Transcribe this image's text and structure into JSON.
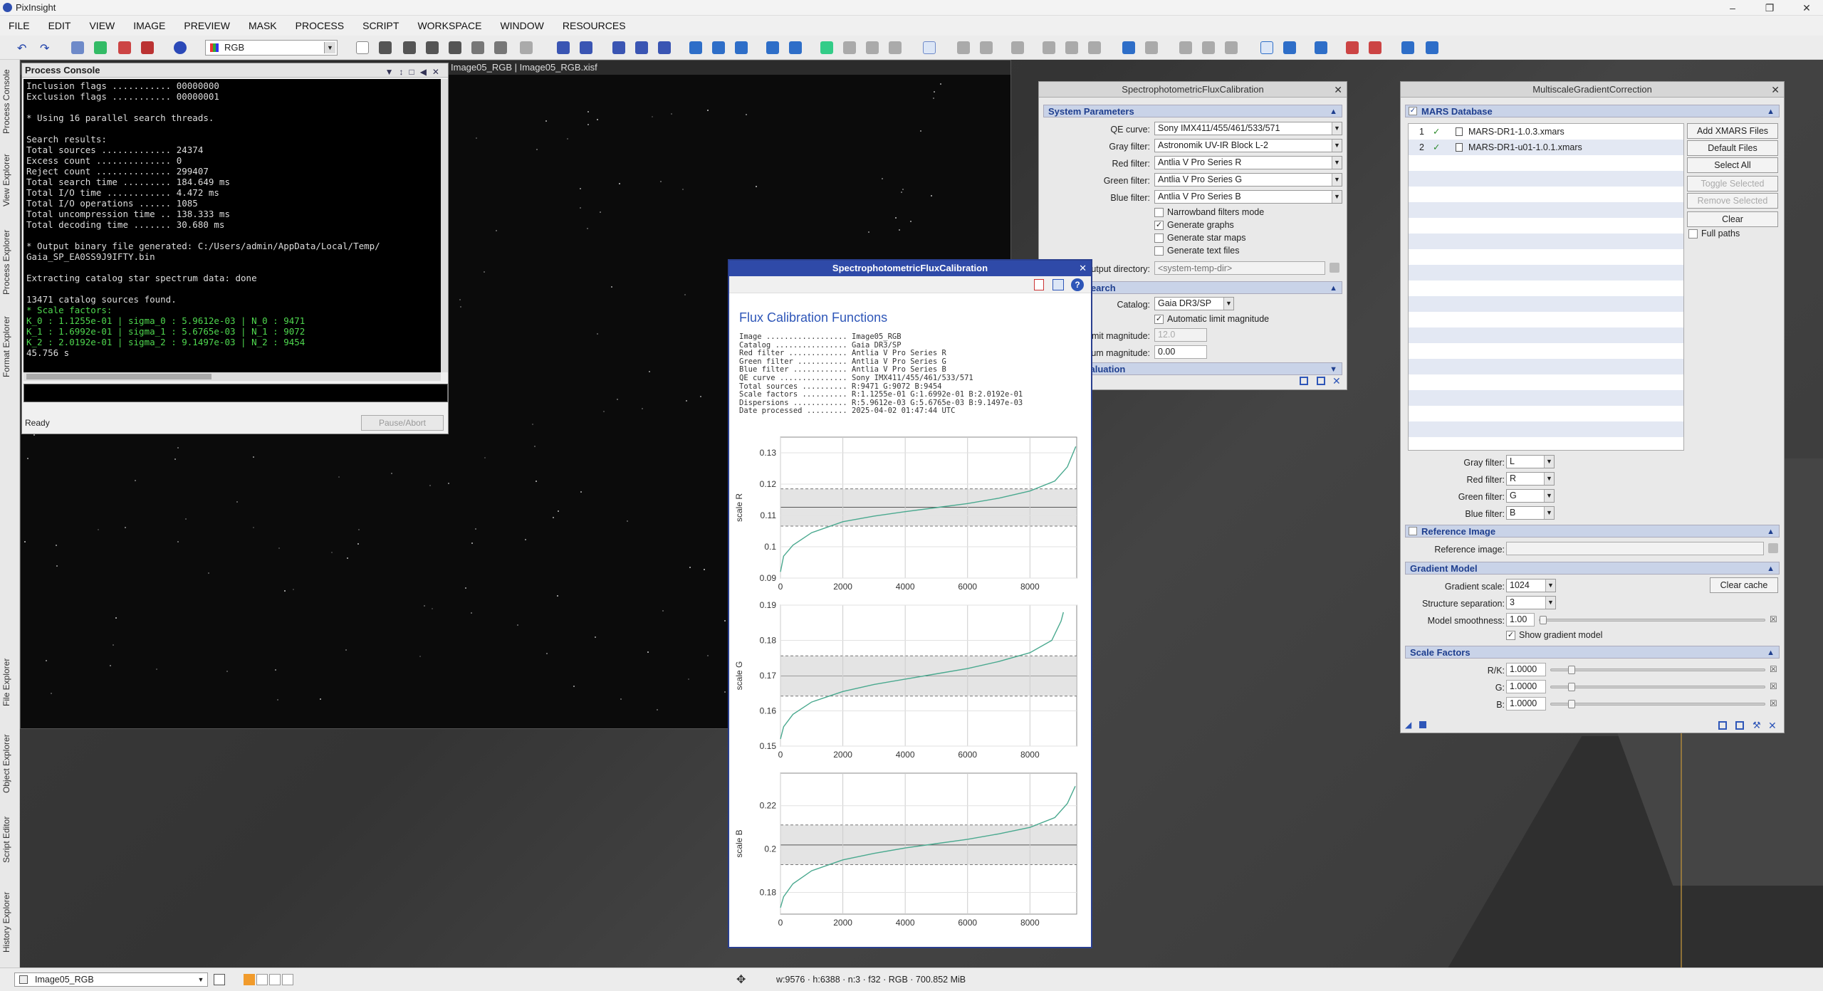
{
  "app": {
    "title": "PixInsight"
  },
  "menu": [
    "FILE",
    "EDIT",
    "VIEW",
    "IMAGE",
    "PREVIEW",
    "MASK",
    "PROCESS",
    "SCRIPT",
    "WORKSPACE",
    "WINDOW",
    "RESOURCES"
  ],
  "toolbar": {
    "color_space": "RGB"
  },
  "left_dock": [
    "Process Console",
    "View Explorer",
    "Process Explorer",
    "Format Explorer",
    "File Explorer",
    "Object Explorer",
    "Script Editor",
    "History Explorer"
  ],
  "image_window": {
    "title": "Image05_RGB | Image05_RGB.xisf"
  },
  "console": {
    "title": "Process Console",
    "lines": [
      "Inclusion flags ........... 00000000",
      "Exclusion flags ........... 00000001",
      "",
      "* Using 16 parallel search threads.",
      "",
      "Search results:",
      "Total sources ............. 24374",
      "Excess count .............. 0",
      "Reject count .............. 299407",
      "Total search time ......... 184.649 ms",
      "Total I/O time ............ 4.472 ms",
      "Total I/O operations ...... 1085",
      "Total uncompression time .. 138.333 ms",
      "Total decoding time ....... 30.680 ms",
      "",
      "* Output binary file generated: C:/Users/admin/AppData/Local/Temp/",
      "Gaia_SP_EA0SS9J9IFTY.bin",
      "",
      "Extracting catalog star spectrum data: done",
      "",
      "13471 catalog sources found."
    ],
    "green_lines": [
      "* Scale factors:",
      "K_0 : 1.1255e-01 | sigma_0 : 5.9612e-03 | N_0 : 9471",
      "K_1 : 1.6992e-01 | sigma_1 : 5.6765e-03 | N_1 : 9072",
      "K_2 : 2.0192e-01 | sigma_2 : 9.1497e-03 | N_2 : 9454"
    ],
    "elapsed": "45.756 s",
    "status": "Ready",
    "pause_label": "Pause/Abort"
  },
  "spfc": {
    "title": "SpectrophotometricFluxCalibration",
    "sec_system": "System Parameters",
    "qe_label": "QE curve:",
    "qe_value": "Sony IMX411/455/461/533/571",
    "gray_label": "Gray filter:",
    "gray_value": "Astronomik UV-IR Block L-2",
    "red_label": "Red filter:",
    "red_value": "Antlia V Pro Series R",
    "green_label": "Green filter:",
    "green_value": "Antlia V Pro Series G",
    "blue_label": "Blue filter:",
    "blue_value": "Antlia V Pro Series B",
    "narrowband": "Narrowband filters mode",
    "gen_graphs": "Generate graphs",
    "gen_star_maps": "Generate star maps",
    "gen_text": "Generate text files",
    "outdir_label": "Output directory:",
    "outdir_placeholder": "<system-temp-dir>",
    "sec_search": "Catalog Search",
    "catalog_label": "Catalog:",
    "catalog_value": "Gaia DR3/SP",
    "auto_limit": "Automatic limit magnitude",
    "limit_label": "Limit magnitude:",
    "limit_value": "12.0",
    "minmag_label": "Minimum magnitude:",
    "minmag_value": "0.00",
    "sec_signal": "Signal Evaluation"
  },
  "mgc": {
    "title": "MultiscaleGradientCorrection",
    "sec_mars": "MARS Database",
    "files": [
      {
        "n": "1",
        "name": "MARS-DR1-1.0.3.xmars"
      },
      {
        "n": "2",
        "name": "MARS-DR1-u01-1.0.1.xmars"
      }
    ],
    "btn_add": "Add XMARS Files",
    "btn_default": "Default Files",
    "btn_selall": "Select All",
    "btn_toggle": "Toggle Selected",
    "btn_remove": "Remove Selected",
    "btn_clear": "Clear",
    "full_paths": "Full paths",
    "gray_label": "Gray filter:",
    "gray_value": "L",
    "red_label": "Red filter:",
    "red_value": "R",
    "green_label": "Green filter:",
    "green_value": "G",
    "blue_label": "Blue filter:",
    "blue_value": "B",
    "sec_ref": "Reference Image",
    "ref_label": "Reference image:",
    "sec_grad": "Gradient Model",
    "scale_label": "Gradient scale:",
    "scale_value": "1024",
    "clear_cache": "Clear cache",
    "struct_label": "Structure separation:",
    "struct_value": "3",
    "smooth_label": "Model smoothness:",
    "smooth_value": "1.00",
    "show_model": "Show gradient model",
    "sec_scale": "Scale Factors",
    "rk_label": "R/K:",
    "rk_value": "1.0000",
    "g_label": "G:",
    "g_value": "1.0000",
    "b_label": "B:",
    "b_value": "1.0000"
  },
  "flux": {
    "window_title": "SpectrophotometricFluxCalibration",
    "heading": "Flux Calibration Functions",
    "info": [
      "Image .................. Image05_RGB",
      "Catalog ................ Gaia DR3/SP",
      "Red filter ............. Antlia V Pro Series R",
      "Green filter ........... Antlia V Pro Series G",
      "Blue filter ............ Antlia V Pro Series B",
      "QE curve ............... Sony IMX411/455/461/533/571",
      "Total sources .......... R:9471 G:9072 B:9454",
      "Scale factors .......... R:1.1255e-01 G:1.6992e-01 B:2.0192e-01",
      "Dispersions ............ R:5.9612e-03 G:5.6765e-03 B:9.1497e-03",
      "Date processed ......... 2025-04-02 01:47:44 UTC"
    ]
  },
  "chart_data": [
    {
      "type": "line",
      "ylabel": "scale R",
      "xlim": [
        0,
        9500
      ],
      "ylim": [
        0.09,
        0.135
      ],
      "xticks": [
        "0",
        "2000",
        "4000",
        "6000",
        "8000"
      ],
      "yticks": [
        "0.09",
        "0.1",
        "0.11",
        "0.12",
        "0.13"
      ],
      "ytick_values": [
        0.09,
        0.1,
        0.11,
        0.12,
        0.13
      ],
      "center": 0.1126,
      "band": [
        0.1066,
        0.1185
      ],
      "x": [
        0,
        100,
        400,
        1000,
        2000,
        3000,
        4000,
        5000,
        6000,
        7000,
        8000,
        8800,
        9200,
        9471
      ],
      "values": [
        0.092,
        0.097,
        0.1005,
        0.1045,
        0.108,
        0.1098,
        0.1112,
        0.1125,
        0.1138,
        0.1155,
        0.1178,
        0.121,
        0.1255,
        0.132
      ]
    },
    {
      "type": "line",
      "ylabel": "scale G",
      "xlim": [
        0,
        9500
      ],
      "ylim": [
        0.15,
        0.19
      ],
      "xticks": [
        "0",
        "2000",
        "4000",
        "6000",
        "8000"
      ],
      "yticks": [
        "0.15",
        "0.16",
        "0.17",
        "0.18",
        "0.19"
      ],
      "ytick_values": [
        0.15,
        0.16,
        0.17,
        0.18,
        0.19
      ],
      "center": 0.1699,
      "band": [
        0.1642,
        0.1756
      ],
      "x": [
        0,
        100,
        400,
        1000,
        2000,
        3000,
        4000,
        5000,
        6000,
        7000,
        8000,
        8700,
        9000,
        9072
      ],
      "values": [
        0.152,
        0.1555,
        0.159,
        0.1625,
        0.1655,
        0.1675,
        0.169,
        0.1705,
        0.172,
        0.174,
        0.1765,
        0.18,
        0.1855,
        0.188
      ]
    },
    {
      "type": "line",
      "ylabel": "scale B",
      "xlim": [
        0,
        9500
      ],
      "ylim": [
        0.17,
        0.235
      ],
      "xticks": [
        "0",
        "2000",
        "4000",
        "6000",
        "8000"
      ],
      "yticks": [
        "0.18",
        "0.2",
        "0.22"
      ],
      "ytick_values": [
        0.18,
        0.2,
        0.22
      ],
      "center": 0.2019,
      "band": [
        0.1928,
        0.2111
      ],
      "x": [
        0,
        100,
        400,
        1000,
        2000,
        3000,
        4000,
        5000,
        6000,
        7000,
        8000,
        8800,
        9200,
        9454
      ],
      "values": [
        0.173,
        0.178,
        0.184,
        0.19,
        0.195,
        0.198,
        0.2005,
        0.2025,
        0.2045,
        0.207,
        0.21,
        0.2145,
        0.221,
        0.229
      ]
    }
  ],
  "statusbar": {
    "view": "Image05_RGB",
    "info": "w:9576 · h:6388 · n:3 · f32 · RGB · 700.852 MiB"
  }
}
